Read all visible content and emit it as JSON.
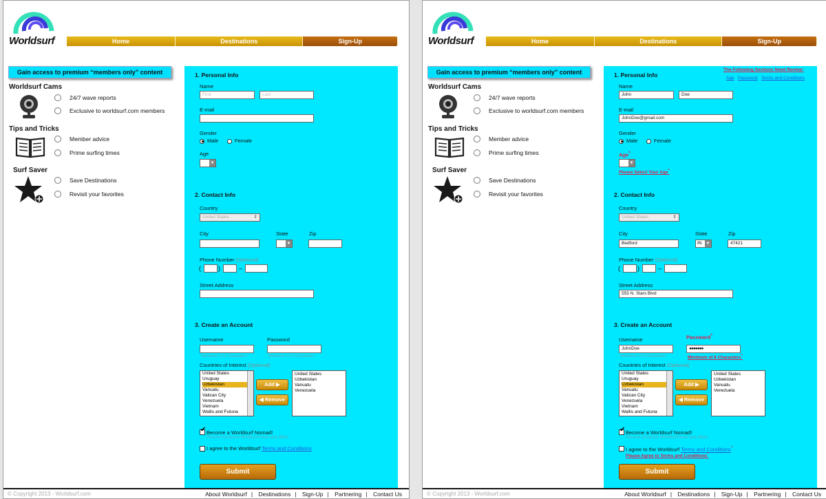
{
  "brand": {
    "name": "Worldsurf"
  },
  "nav": {
    "items": [
      "Home",
      "Destinations",
      "Sign-Up"
    ],
    "active": "Sign-Up"
  },
  "colors": {
    "form_bg": "#00e8ff",
    "nav_gold": "#d9a30f",
    "nav_active": "#b0600e",
    "error": "#e21b4a"
  },
  "benefits": {
    "banner": "Gain access to premium “members only” content",
    "cams": {
      "title": "Worldsurf Cams",
      "icon": "webcam-icon",
      "items": [
        "24/7 wave reports",
        "Exclusive to worldsurf.com members"
      ]
    },
    "tips": {
      "title": "Tips and Tricks",
      "icon": "book-icon",
      "items": [
        "Member advice",
        "Prime surfing times"
      ]
    },
    "saver": {
      "title": "Surf Saver",
      "icon": "star-plus-icon",
      "items": [
        "Save Destinations",
        "Revisit your favorites"
      ]
    }
  },
  "form": {
    "personal": {
      "title": "1. Personal Info",
      "name_label": "Name",
      "first_placeholder": "First",
      "last_placeholder": "Last",
      "email_label": "E-mail",
      "gender_label": "Gender",
      "male": "Male",
      "female": "Female",
      "age_label": "Age"
    },
    "contact": {
      "title": "2. Contact Info",
      "country_label": "Country",
      "country_value": "United States",
      "city_label": "City",
      "state_label": "State",
      "zip_label": "Zip",
      "phone_label": "Phone Number",
      "optional": "(Optional)",
      "paren_open": "(",
      "paren_close": ")",
      "dash": "–",
      "street_label": "Street Address"
    },
    "account": {
      "title": "3. Create an Account",
      "username_label": "Username",
      "password_label": "Password",
      "username_hint": "Minimum of 6 Characters",
      "password_hint": "Minimum of 8 Characters",
      "countries_label": "Countries of Interest",
      "countries_list": [
        "United States",
        "Uruguay",
        "Uzbekistan",
        "Vanuatu",
        "Vatican City",
        "Venezuela",
        "Vietnam",
        "Wallis and Futuna"
      ],
      "countries_highlighted": "Uzbekistan",
      "selected_countries": [
        "United States",
        "Uzbekistan",
        "Vanuatu",
        "Venezuela"
      ],
      "add_button": "Add ▶",
      "remove_button": "◀ Remove",
      "nomad_label": "Become a Worldsurf Nomad!",
      "nomad_sub": "Receive exclusive Worldsurf news and offers",
      "agree_prefix": "I agree to the Worldsurf ",
      "agree_link": "Terms and Conditions",
      "submit": "Submit"
    }
  },
  "filled": {
    "first": "John",
    "last": "Doe",
    "email": "JohnDoe@gmail.com",
    "city": "Bedford",
    "state": "IN",
    "zip": "47421",
    "street": "555 N. Stars Blvd",
    "username": "JohnDoe",
    "password": "●●●●●●●"
  },
  "validation": {
    "review_title": "The Following Sections Need Review:",
    "review_links": [
      "Age",
      "Password",
      "Terms and Conditions"
    ],
    "asterisk": "*",
    "age_error": "Please Select Your Age",
    "password_error": "Minimum of 8 Characters",
    "terms_error": "Please Agree to Terms and Conditions"
  },
  "footer": {
    "copyright": "©   Copyright    2013   -   Worldsurf.com",
    "links": [
      "About Worldsurf",
      "Destinations",
      "Sign-Up",
      "Partnering",
      "Contact Us"
    ],
    "sep": "|"
  }
}
